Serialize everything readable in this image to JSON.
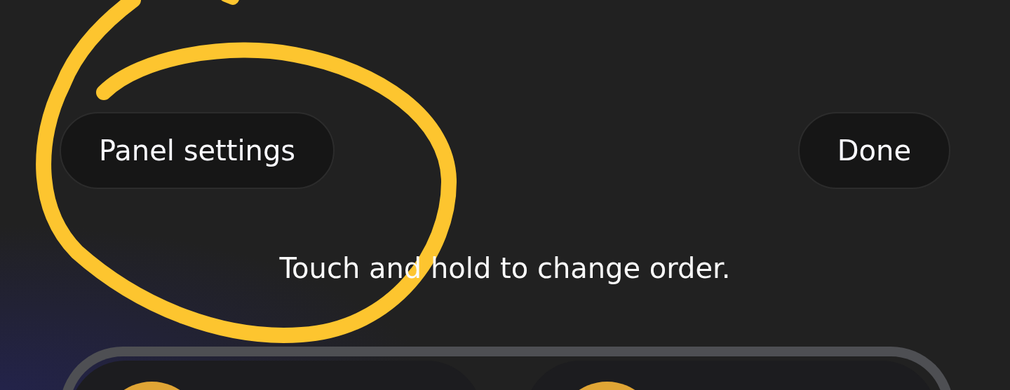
{
  "top_bar": {
    "left_button": "Panel settings",
    "right_button": "Done"
  },
  "hint": "Touch and hold to change order.",
  "quick_panel": {
    "tiles": [
      {
        "active": true
      },
      {
        "active": true
      }
    ]
  }
}
